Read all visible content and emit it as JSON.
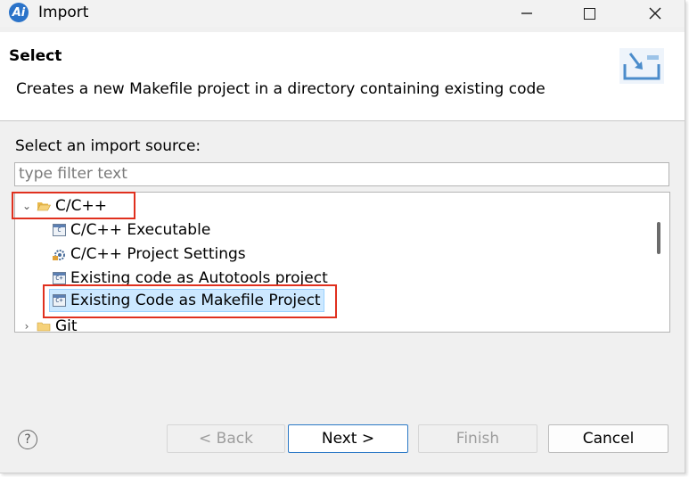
{
  "window": {
    "title": "Import",
    "app_icon_text": "Ai",
    "minimize_icon": "minimize-icon",
    "maximize_icon": "maximize-icon",
    "close_icon": "close-icon"
  },
  "header": {
    "title": "Select",
    "description": "Creates a new Makefile project in a directory containing existing code",
    "icon": "import-wizard-icon"
  },
  "prompt": "Select an import source:",
  "filter": {
    "placeholder": "type filter text",
    "value": ""
  },
  "tree": {
    "items": [
      {
        "label": "C/C++",
        "expanded": true,
        "icon": "folder-icon",
        "highlighted": true
      },
      {
        "label": "C/C++ Executable",
        "icon": "c-executable-icon",
        "parent": "C/C++"
      },
      {
        "label": "C/C++ Project Settings",
        "icon": "project-settings-icon",
        "parent": "C/C++"
      },
      {
        "label": "Existing code as Autotools project",
        "icon": "cpp-project-icon",
        "parent": "C/C++"
      },
      {
        "label": "Existing Code as Makefile Project",
        "icon": "cpp-project-icon",
        "parent": "C/C++",
        "selected": true,
        "highlighted": true
      },
      {
        "label": "Git",
        "expanded": false,
        "icon": "folder-icon"
      }
    ]
  },
  "buttons": {
    "back": "< Back",
    "next": "Next >",
    "finish": "Finish",
    "cancel": "Cancel"
  },
  "help_icon": "help-icon",
  "colors": {
    "selection": "#cce8ff",
    "highlight_border": "#e0301e",
    "primary_button_border": "#2b79c6"
  }
}
